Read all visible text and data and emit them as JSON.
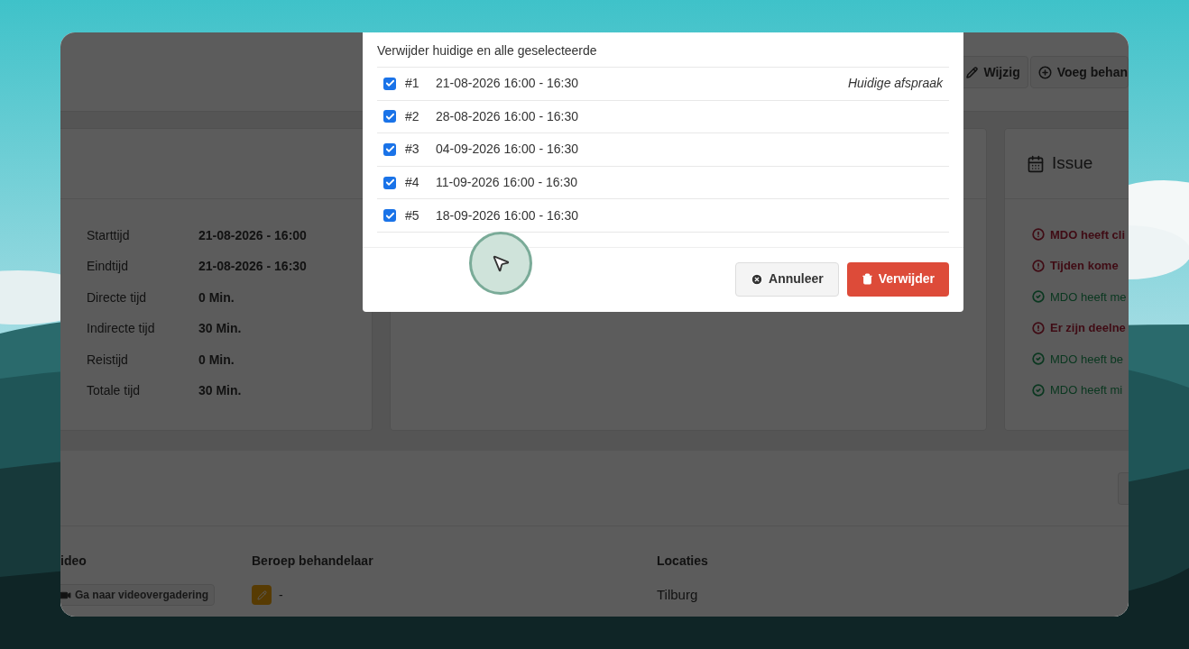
{
  "header": {
    "buttons": [
      {
        "kind": "edit",
        "label": "Wijzig"
      },
      {
        "kind": "add",
        "label": "Voeg behan"
      }
    ]
  },
  "details": {
    "rows": [
      {
        "label": "Starttijd",
        "value": "21-08-2026 - 16:00"
      },
      {
        "label": "Eindtijd",
        "value": "21-08-2026 - 16:30"
      },
      {
        "label": "Directe tijd",
        "value": "0 Min."
      },
      {
        "label": "Indirecte tijd",
        "value": "30 Min."
      },
      {
        "label": "Reistijd",
        "value": "0 Min."
      },
      {
        "label": "Totale tijd",
        "value": "30 Min."
      }
    ]
  },
  "issues": {
    "title": "Issue",
    "items": [
      {
        "kind": "error",
        "text": "MDO heeft cli"
      },
      {
        "kind": "error",
        "text": "Tijden kome"
      },
      {
        "kind": "ok",
        "text": "MDO heeft me"
      },
      {
        "kind": "error",
        "text": "Er zijn deelne"
      },
      {
        "kind": "ok",
        "text": "MDO heeft be"
      },
      {
        "kind": "ok",
        "text": "MDO heeft mi"
      }
    ]
  },
  "table": {
    "columns": [
      "ideo",
      "Beroep behandelaar",
      "Locaties"
    ],
    "row": {
      "video_link": "Ga naar videovergadering",
      "profession": "-",
      "location": "Tilburg"
    }
  },
  "modal": {
    "title": "Verwijder huidige en alle geselecteerde",
    "appointments": [
      {
        "number": "#1",
        "datetime": "21-08-2026 16:00 - 16:30",
        "checked": true,
        "note": "Huidige afspraak"
      },
      {
        "number": "#2",
        "datetime": "28-08-2026 16:00 - 16:30",
        "checked": true
      },
      {
        "number": "#3",
        "datetime": "04-09-2026 16:00 - 16:30",
        "checked": true
      },
      {
        "number": "#4",
        "datetime": "11-09-2026 16:00 - 16:30",
        "checked": true
      },
      {
        "number": "#5",
        "datetime": "18-09-2026 16:00 - 16:30",
        "checked": true
      }
    ],
    "buttons": [
      {
        "kind": "cancel",
        "label": "Annuleer"
      },
      {
        "kind": "delete",
        "label": "Verwijder"
      }
    ]
  }
}
